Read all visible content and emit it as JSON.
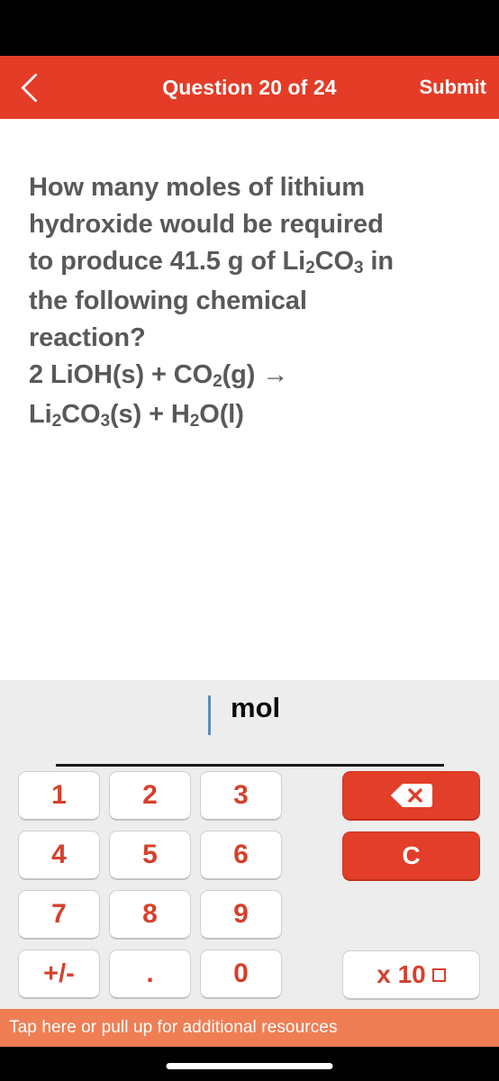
{
  "header": {
    "back_icon": "chevron-left-icon",
    "title": "Question 20 of 24",
    "submit_label": "Submit"
  },
  "question": {
    "line1": "How many moles of lithium",
    "line2": "hydroxide would be required",
    "line3_a": "to produce 41.5 g of Li",
    "line3_sub1": "2",
    "line3_b": "CO",
    "line3_sub2": "3",
    "line3_c": " in",
    "line4": "the following chemical",
    "line5": "reaction?",
    "eq1_a": "2 LiOH(s) + CO",
    "eq1_sub": "2",
    "eq1_b": "(g) →",
    "eq2_a": "Li",
    "eq2_sub1": "2",
    "eq2_b": "CO",
    "eq2_sub2": "3",
    "eq2_c": "(s) + H",
    "eq2_sub3": "2",
    "eq2_d": "O(l)"
  },
  "answer": {
    "value": "",
    "unit": "mol",
    "caret_visible": true
  },
  "keypad": {
    "keys": [
      {
        "label": "1",
        "name": "key-1"
      },
      {
        "label": "2",
        "name": "key-2"
      },
      {
        "label": "3",
        "name": "key-3"
      },
      {
        "label": "4",
        "name": "key-4"
      },
      {
        "label": "5",
        "name": "key-5"
      },
      {
        "label": "6",
        "name": "key-6"
      },
      {
        "label": "7",
        "name": "key-7"
      },
      {
        "label": "8",
        "name": "key-8"
      },
      {
        "label": "9",
        "name": "key-9"
      },
      {
        "label": "+/-",
        "name": "key-plus-minus"
      },
      {
        "label": ".",
        "name": "key-decimal"
      },
      {
        "label": "0",
        "name": "key-0"
      }
    ],
    "backspace_icon": "backspace-icon",
    "clear_label": "C",
    "exponent_label": "x 10"
  },
  "footer": {
    "resources_text": "Tap here or pull up for additional resources"
  },
  "colors": {
    "header_red": "#E43C27",
    "key_red": "#E23E29",
    "digit_red": "#D6402B",
    "keypad_bg": "#EDEDED",
    "resources_orange": "#EF7E55",
    "question_text": "#57595A",
    "caret_blue": "#5B8CB8"
  }
}
